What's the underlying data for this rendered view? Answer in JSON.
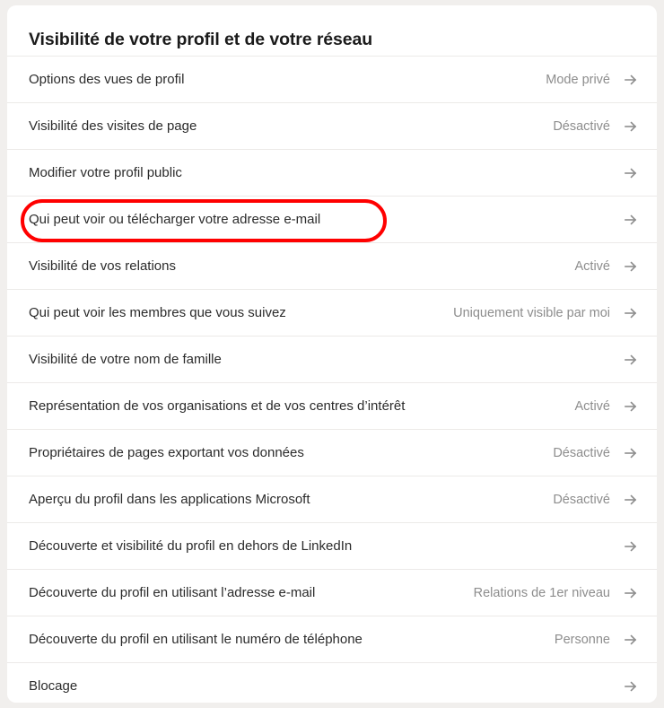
{
  "card": {
    "title": "Visibilité de votre profil et de votre réseau",
    "arrow_icon": "arrow-right-icon",
    "accent_highlight_color": "#ff0000",
    "value_text_color": "#8d8d8d",
    "label_text_color": "#2b2b2b",
    "background_color": "#ffffff",
    "page_background_color": "#f1efed",
    "rows": [
      {
        "label": "Options des vues de profil",
        "value": "Mode privé",
        "highlighted": false
      },
      {
        "label": "Visibilité des visites de page",
        "value": "Désactivé",
        "highlighted": false
      },
      {
        "label": "Modifier votre profil public",
        "value": "",
        "highlighted": false
      },
      {
        "label": "Qui peut voir ou télécharger votre adresse e-mail",
        "value": "",
        "highlighted": true
      },
      {
        "label": "Visibilité de vos relations",
        "value": "Activé",
        "highlighted": false
      },
      {
        "label": "Qui peut voir les membres que vous suivez",
        "value": "Uniquement visible par moi",
        "highlighted": false
      },
      {
        "label": "Visibilité de votre nom de famille",
        "value": "",
        "highlighted": false
      },
      {
        "label": "Représentation de vos organisations et de vos centres d’intérêt",
        "value": "Activé",
        "highlighted": false
      },
      {
        "label": "Propriétaires de pages exportant vos données",
        "value": "Désactivé",
        "highlighted": false
      },
      {
        "label": "Aperçu du profil dans les applications Microsoft",
        "value": "Désactivé",
        "highlighted": false
      },
      {
        "label": "Découverte et visibilité du profil en dehors de LinkedIn",
        "value": "",
        "highlighted": false
      },
      {
        "label": "Découverte du profil en utilisant l’adresse e-mail",
        "value": "Relations de 1er niveau",
        "highlighted": false
      },
      {
        "label": "Découverte du profil en utilisant le numéro de téléphone",
        "value": "Personne",
        "highlighted": false
      },
      {
        "label": "Blocage",
        "value": "",
        "highlighted": false
      }
    ]
  }
}
